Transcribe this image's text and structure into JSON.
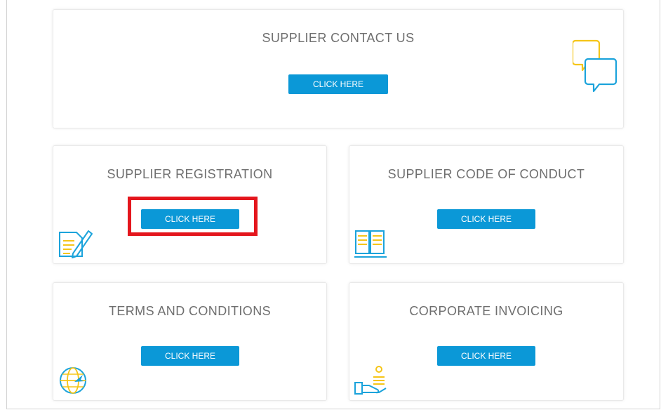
{
  "cards": {
    "contact": {
      "title": "SUPPLIER CONTACT US",
      "button": "CLICK HERE",
      "icon": "chat-bubbles-icon"
    },
    "registration": {
      "title": "SUPPLIER REGISTRATION",
      "button": "CLICK HERE",
      "icon": "document-pen-icon"
    },
    "conduct": {
      "title": "SUPPLIER CODE OF CONDUCT",
      "button": "CLICK HERE",
      "icon": "open-book-icon"
    },
    "terms": {
      "title": "TERMS AND CONDITIONS",
      "button": "CLICK HERE",
      "icon": "globe-icon"
    },
    "invoicing": {
      "title": "CORPORATE INVOICING",
      "button": "CLICK HERE",
      "icon": "hand-coins-icon"
    }
  },
  "colors": {
    "button": "#0b98d7",
    "highlight": "#e4161d",
    "icon_blue": "#1ba3db",
    "icon_yellow": "#f5c518"
  }
}
